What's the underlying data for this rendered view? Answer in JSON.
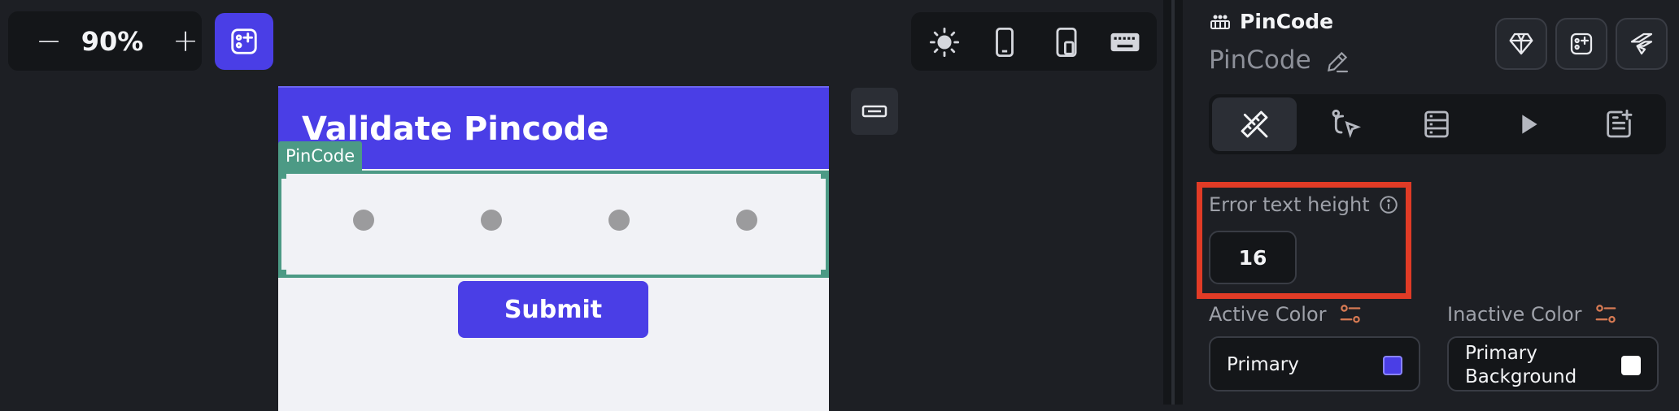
{
  "toolbar": {
    "zoom_out": "−",
    "zoom_level": "90%",
    "zoom_in": "+"
  },
  "canvas": {
    "appbar_title": "Validate Pincode",
    "pin_tag": "PinCode",
    "submit_label": "Submit",
    "pin_digits": 4
  },
  "panel": {
    "widget_type": "PinCode",
    "widget_name": "PinCode",
    "error_text_height_label": "Error text height",
    "error_text_height_value": "16",
    "active_color_label": "Active Color",
    "active_color_value": "Primary",
    "inactive_color_label": "Inactive Color",
    "inactive_color_value_line1": "Primary",
    "inactive_color_value_line2": "Background"
  },
  "colors": {
    "brand": "#4a3ee6",
    "selection": "#4c9a85",
    "highlight": "#e13b26",
    "inactive_swatch": "#ffffff"
  }
}
